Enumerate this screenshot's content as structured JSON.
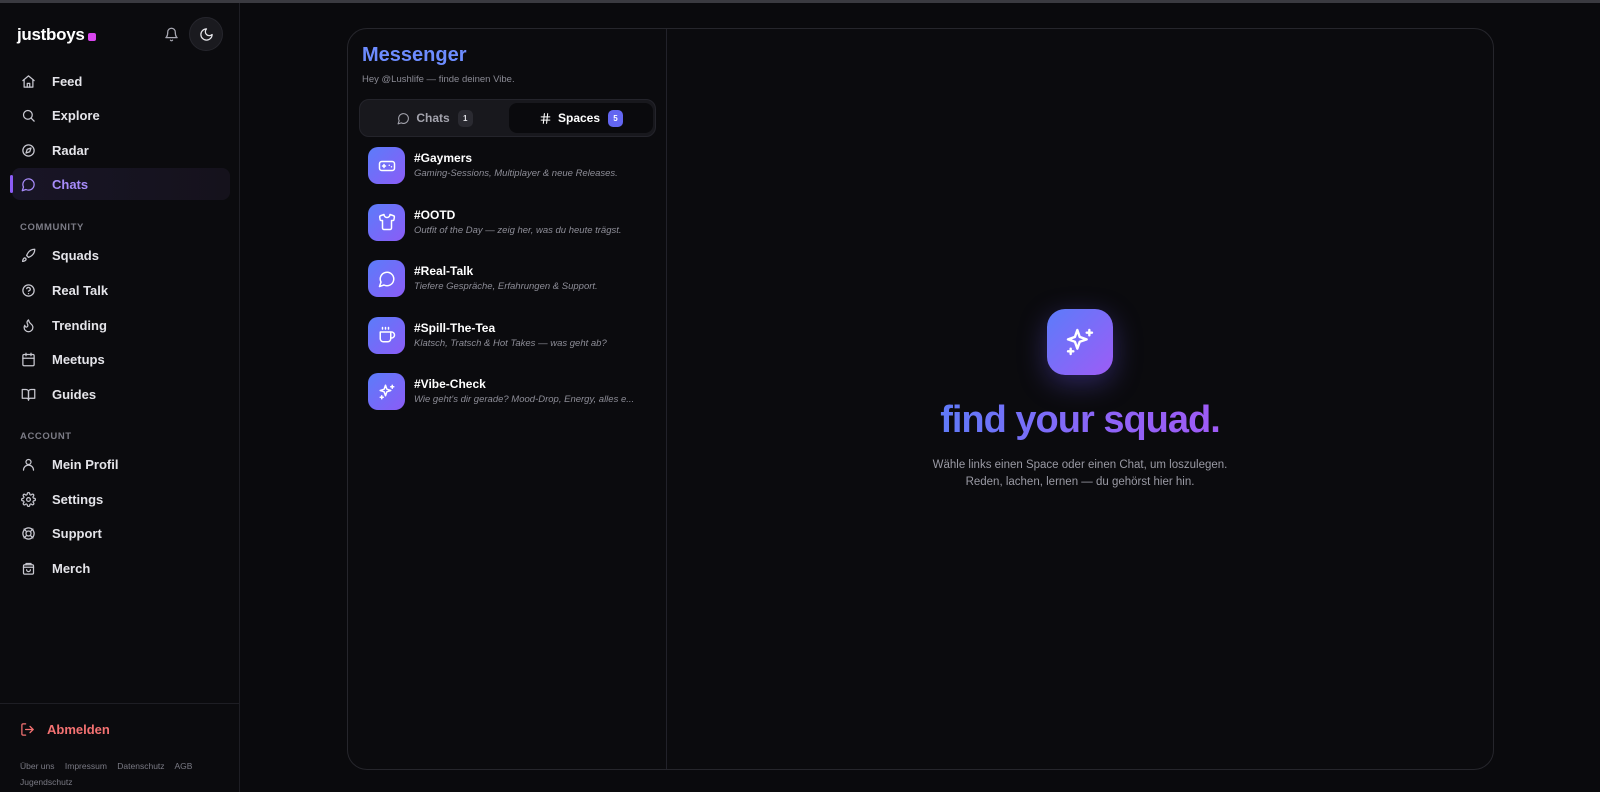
{
  "brand": {
    "name": "justboys"
  },
  "sidebar": {
    "main_items": [
      {
        "label": "Feed",
        "icon": "home-icon"
      },
      {
        "label": "Explore",
        "icon": "search-icon"
      },
      {
        "label": "Radar",
        "icon": "compass-icon"
      },
      {
        "label": "Chats",
        "icon": "chat-bubble-icon",
        "active": true
      }
    ],
    "community_label": "COMMUNITY",
    "community_items": [
      {
        "label": "Squads",
        "icon": "rocket-icon"
      },
      {
        "label": "Real Talk",
        "icon": "help-circle-icon"
      },
      {
        "label": "Trending",
        "icon": "flame-icon"
      },
      {
        "label": "Meetups",
        "icon": "calendar-icon"
      },
      {
        "label": "Guides",
        "icon": "book-icon"
      }
    ],
    "account_label": "ACCOUNT",
    "account_items": [
      {
        "label": "Mein Profil",
        "icon": "user-icon"
      },
      {
        "label": "Settings",
        "icon": "gear-icon"
      },
      {
        "label": "Support",
        "icon": "lifebuoy-icon"
      },
      {
        "label": "Merch",
        "icon": "shopping-bag-icon"
      }
    ],
    "logout_label": "Abmelden",
    "footer_links": [
      "Über uns",
      "Impressum",
      "Datenschutz",
      "AGB",
      "Jugendschutz"
    ]
  },
  "messenger": {
    "title": "Messenger",
    "subtitle": "Hey @Lushlife — finde deinen Vibe.",
    "tabs": [
      {
        "label": "Chats",
        "count": "1",
        "active": false
      },
      {
        "label": "Spaces",
        "count": "5",
        "active": true
      }
    ],
    "spaces": [
      {
        "name": "#Gaymers",
        "description": "Gaming-Sessions, Multiplayer & neue Releases.",
        "icon": "gamepad-icon"
      },
      {
        "name": "#OOTD",
        "description": "Outfit of the Day — zeig her, was du heute trägst.",
        "icon": "tshirt-icon"
      },
      {
        "name": "#Real-Talk",
        "description": "Tiefere Gespräche, Erfahrungen & Support.",
        "icon": "chat-bubble-icon"
      },
      {
        "name": "#Spill-The-Tea",
        "description": "Klatsch, Tratsch & Hot Takes — was geht ab?",
        "icon": "cup-icon"
      },
      {
        "name": "#Vibe-Check",
        "description": "Wie geht's dir gerade? Mood-Drop, Energy, alles e...",
        "icon": "sparkles-icon"
      }
    ],
    "empty_state": {
      "icon": "sparkles-icon",
      "title": "find your squad.",
      "line1": "Wähle links einen Space oder einen Chat, um loszulegen.",
      "line2": "Reden, lachen, lernen — du gehörst hier hin."
    }
  },
  "colors": {
    "accent": "#8b5cf6",
    "accent_blue": "#5b7cfa",
    "brand_dot": "#d946ef",
    "logout": "#f47272",
    "background": "#0a0a0d"
  }
}
